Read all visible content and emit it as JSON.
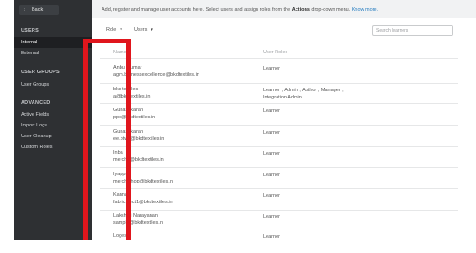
{
  "sidebar": {
    "back_label": "Back",
    "sections": [
      {
        "title": "USERS",
        "items": [
          "Internal",
          "External"
        ]
      },
      {
        "title": "USER GROUPS",
        "items": [
          "User Groups"
        ]
      },
      {
        "title": "ADVANCED",
        "items": [
          "Active Fields",
          "Import Logs",
          "User Cleanup",
          "Custom Roles"
        ]
      }
    ],
    "active_item": "Internal"
  },
  "header": {
    "description_pre": "Add, register and manage user accounts here. Select users and assign roles from the ",
    "description_bold": "Actions",
    "description_post": " drop-down menu. ",
    "know_more": "Know more."
  },
  "filters": {
    "role_label": "Role",
    "users_label": "Users"
  },
  "search": {
    "placeholder": "Search learners"
  },
  "table": {
    "columns": [
      "Name",
      "User Roles"
    ],
    "rows": [
      {
        "name": "Anbu ...umar",
        "email": "agm.b...nessexcellence@bkdtextiles.in",
        "role": "Learner"
      },
      {
        "name": "bks textiles",
        "email": "a@bkdtextiles.in",
        "role": "Learner , Admin , Author , Manager , Integration Admin"
      },
      {
        "name": "Gunasekaran",
        "email": "ppc@bkdtextiles.in",
        "role": "Learner"
      },
      {
        "name": "Gunasekaran",
        "email": "ee.ptwk@bkdtextiles.in",
        "role": "Learner"
      },
      {
        "name": "Inba",
        "email": "merch4@bkdtextiles.in",
        "role": "Learner"
      },
      {
        "name": "Iyappan",
        "email": "merch.shop@bkdtextiles.in",
        "role": "Learner"
      },
      {
        "name": "Kannan",
        "email": "fabric.sect1@bkdtextiles.in",
        "role": "Learner"
      },
      {
        "name": "Lakshmi Narayanan",
        "email": "sample@bkdtextiles.in",
        "role": "Learner"
      },
      {
        "name": "Logesh",
        "email": "",
        "role": "Learner"
      }
    ]
  },
  "colors": {
    "sidebar_bg": "#2e3033",
    "active_bg": "#1e1f22",
    "link": "#2a7fc1",
    "annotation_red": "#e0161d"
  }
}
